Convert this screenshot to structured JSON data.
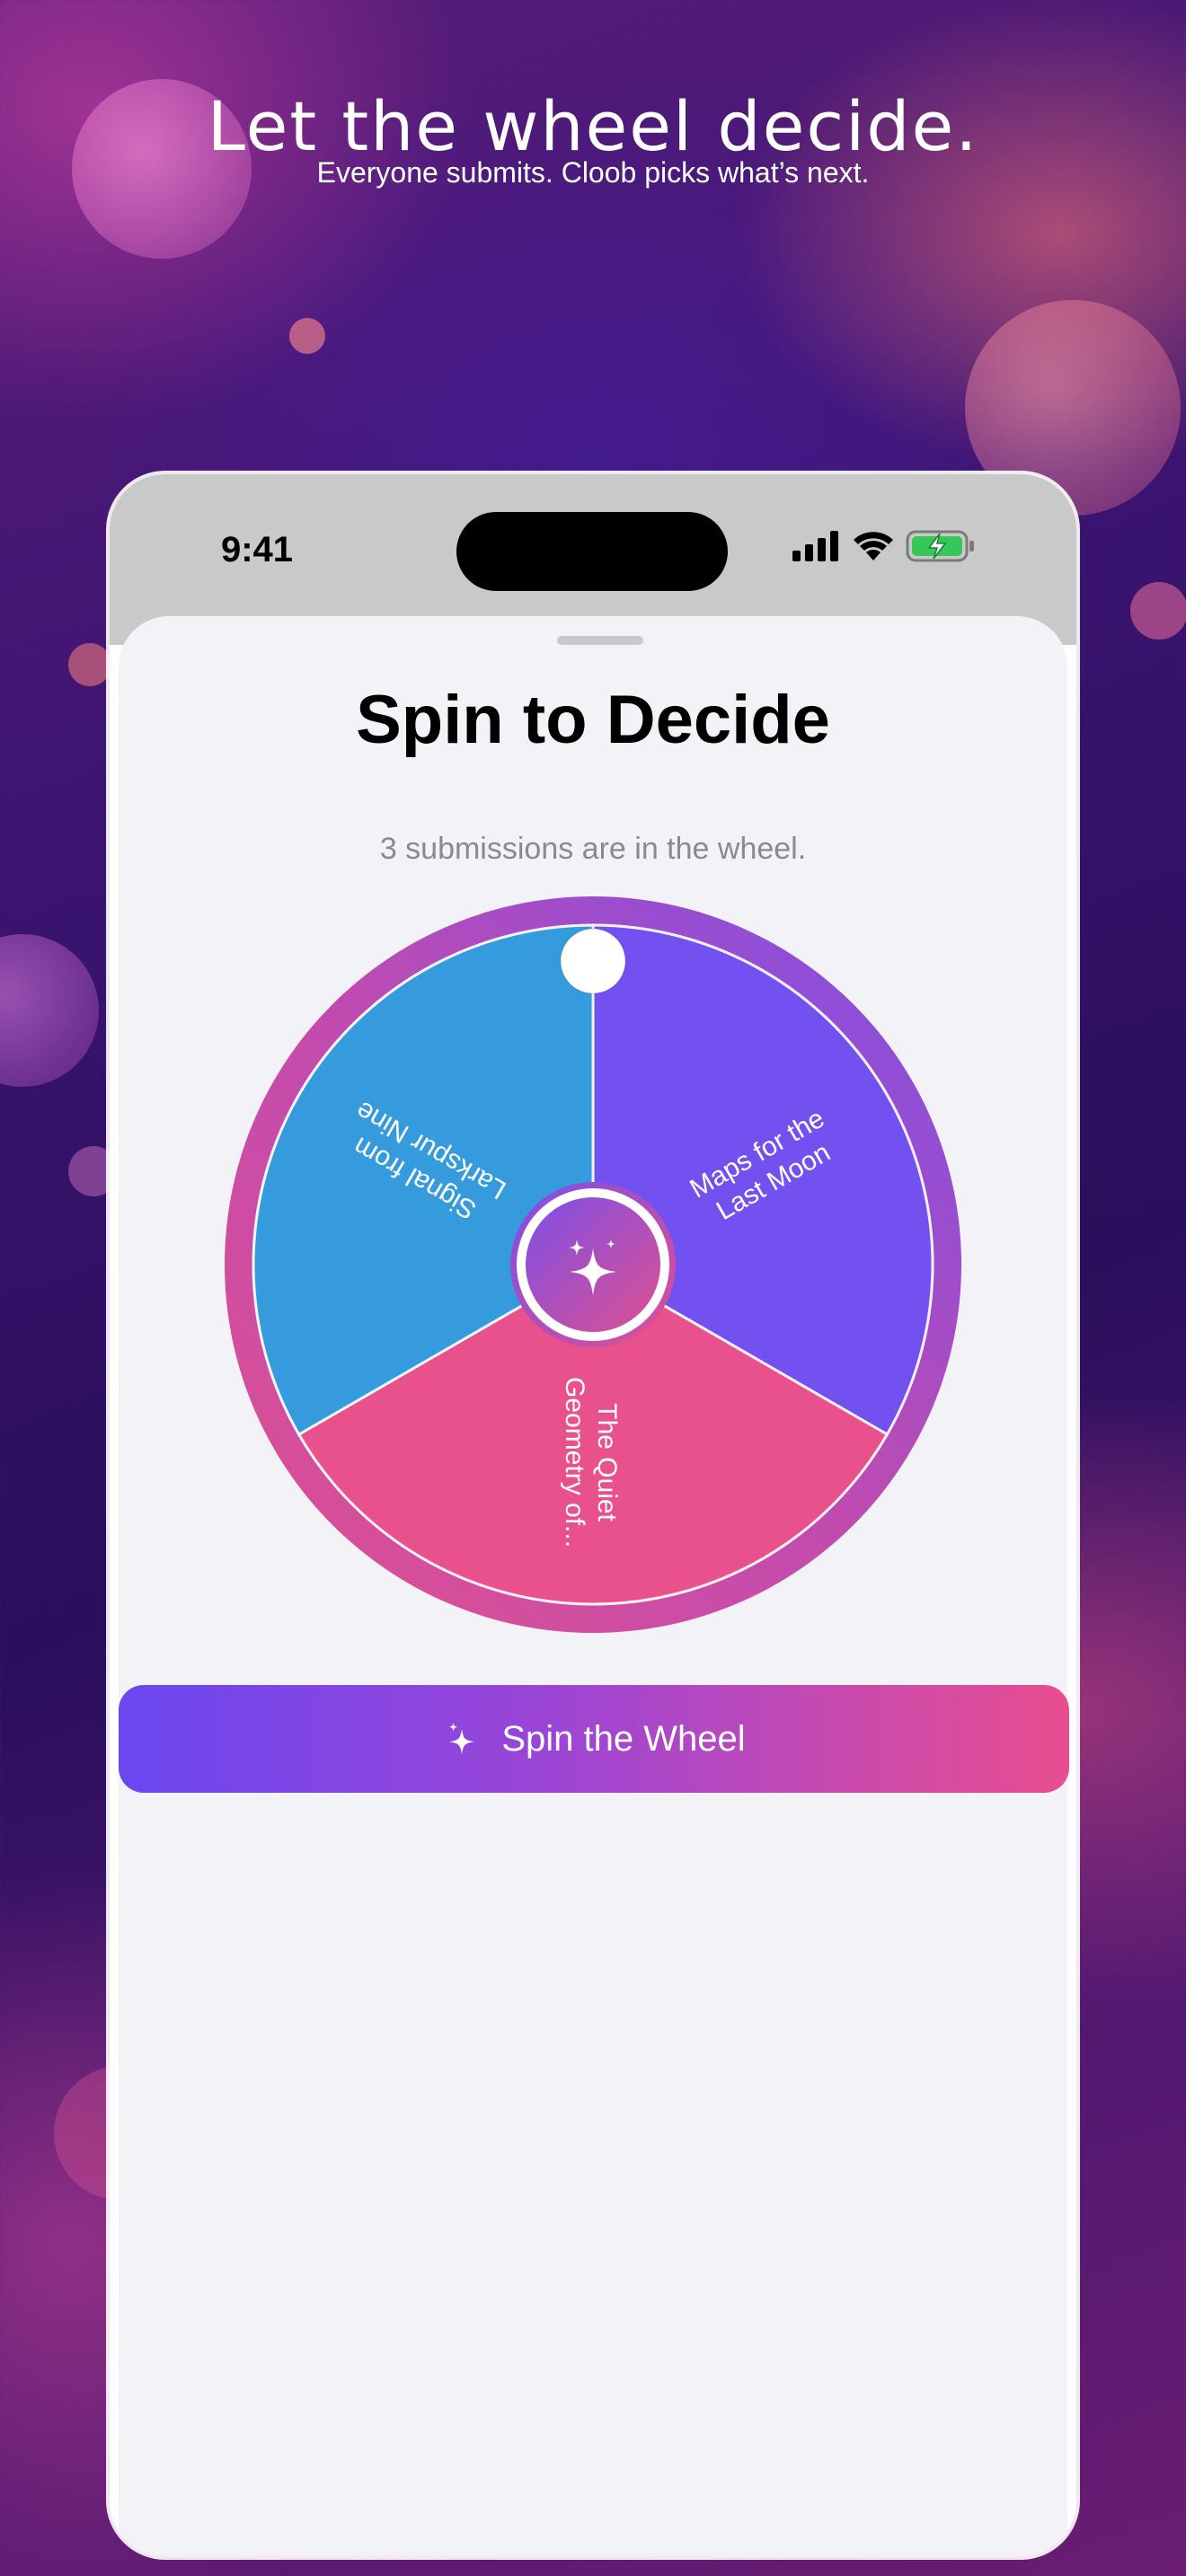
{
  "promo": {
    "title": "Let the wheel decide.",
    "subtitle": "Everyone submits. Cloob picks what’s next."
  },
  "status_bar": {
    "time": "9:41",
    "icons": [
      "cellular-signal-icon",
      "wifi-icon",
      "battery-charging-icon"
    ]
  },
  "sheet": {
    "title": "Spin to Decide",
    "subtitle": "3 submissions are in the wheel."
  },
  "wheel": {
    "segments": [
      {
        "line1": "Maps for the",
        "line2": "Last Moon",
        "color": "#7350f0"
      },
      {
        "line1": "The Quiet",
        "line2": "Geometry of...",
        "color": "#e8518c"
      },
      {
        "line1": "Signal from",
        "line2": "Larkspur Nine",
        "color": "#369bdc"
      }
    ],
    "center_icon": "sparkles-icon",
    "rim_colors": [
      "#7a4fe8",
      "#c04bb0",
      "#e0508f"
    ]
  },
  "action": {
    "label": "Spin the Wheel",
    "icon": "sparkles-icon",
    "gradient": [
      "#6a47f0",
      "#e94e8f"
    ]
  }
}
